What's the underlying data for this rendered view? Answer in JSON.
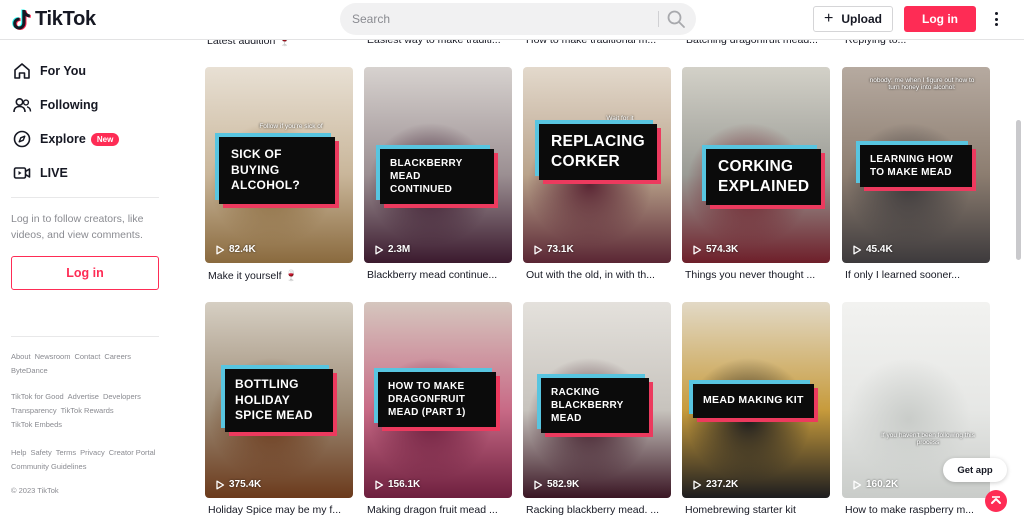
{
  "header": {
    "logo_text": "TikTok",
    "search_placeholder": "Search",
    "upload_label": "Upload",
    "login_label": "Log in"
  },
  "sidebar": {
    "nav": [
      {
        "label": "For You",
        "icon": "home-icon"
      },
      {
        "label": "Following",
        "icon": "following-icon"
      },
      {
        "label": "Explore",
        "icon": "compass-icon",
        "badge": "New"
      },
      {
        "label": "LIVE",
        "icon": "live-icon"
      }
    ],
    "login_prompt": "Log in to follow creators, like videos, and view comments.",
    "login_button": "Log in",
    "footer_groups": [
      [
        "About",
        "Newsroom",
        "Contact",
        "Careers",
        "ByteDance"
      ],
      [
        "TikTok for Good",
        "Advertise",
        "Developers",
        "Transparency",
        "TikTok Rewards",
        "TikTok Embeds"
      ],
      [
        "Help",
        "Safety",
        "Terms",
        "Privacy",
        "Creator Portal",
        "Community Guidelines"
      ]
    ],
    "copyright": "© 2023 TikTok"
  },
  "top_row_captions": [
    "Latest addition 🍷",
    "Easiest way to make traditi...",
    "How to make traditional m...",
    "Batching dragonfruit mead...",
    "Replying to..."
  ],
  "videos": [
    {
      "overlay": "SICK OF BUYING ALCOHOL?",
      "small_text": "Follow if you're sick of",
      "views": "82.4K",
      "caption": "Make it yourself 🍷",
      "bg": [
        "#c9b69a",
        "#8a6a3e",
        "#e8e0d4"
      ]
    },
    {
      "overlay": "BLACKBERRY MEAD CONTINUED",
      "views": "2.3M",
      "caption": "Blackberry mead continue...",
      "bg": [
        "#9b8f92",
        "#3b1a2e",
        "#d7d2cf"
      ]
    },
    {
      "overlay": "REPLACING CORKER",
      "small_text": "Wait for it",
      "views": "73.1K",
      "caption": "Out with the old, in with th...",
      "bg": [
        "#b9a38b",
        "#5a2634",
        "#e3d9cc"
      ]
    },
    {
      "overlay": "CORKING EXPLAINED",
      "views": "574.3K",
      "caption": "Things you never thought ...",
      "bg": [
        "#9a9b95",
        "#6e1f2a",
        "#d3d1c8"
      ]
    },
    {
      "overlay": "LEARNING HOW TO MAKE MEAD",
      "small_text": "nobody: me when I figure out how to turn honey into alcohol:",
      "views": "45.4K",
      "caption": "If only I learned sooner...",
      "bg": [
        "#8c7d70",
        "#3d3a3c",
        "#b6aaa0"
      ]
    },
    {
      "overlay": "BOTTLING HOLIDAY SPICE MEAD",
      "views": "375.4K",
      "caption": "Holiday Spice may be my f...",
      "bg": [
        "#9b8973",
        "#6b3a1c",
        "#d6cfc3"
      ]
    },
    {
      "overlay": "HOW TO MAKE DRAGONFRUIT MEAD (PART 1)",
      "views": "156.1K",
      "caption": "Making dragon fruit mead ...",
      "bg": [
        "#c86a86",
        "#6d1f3e",
        "#d5c6be"
      ]
    },
    {
      "overlay": "RACKING BLACKBERRY MEAD",
      "views": "582.9K",
      "caption": "Racking blackberry mead. ...",
      "bg": [
        "#c7c3bd",
        "#3a1624",
        "#e4e1dc"
      ]
    },
    {
      "overlay": "MEAD MAKING KIT",
      "views": "237.2K",
      "caption": "Homebrewing starter kit",
      "bg": [
        "#c79b3c",
        "#1d1d1f",
        "#e2d9c6"
      ]
    },
    {
      "overlay": "",
      "small_text": "If you haven't been following this process",
      "views": "160.2K",
      "caption": "How to make raspberry m...",
      "bg": [
        "#e6e7e5",
        "#c9ccc9",
        "#f2f2f0"
      ]
    }
  ],
  "get_app_label": "Get app"
}
